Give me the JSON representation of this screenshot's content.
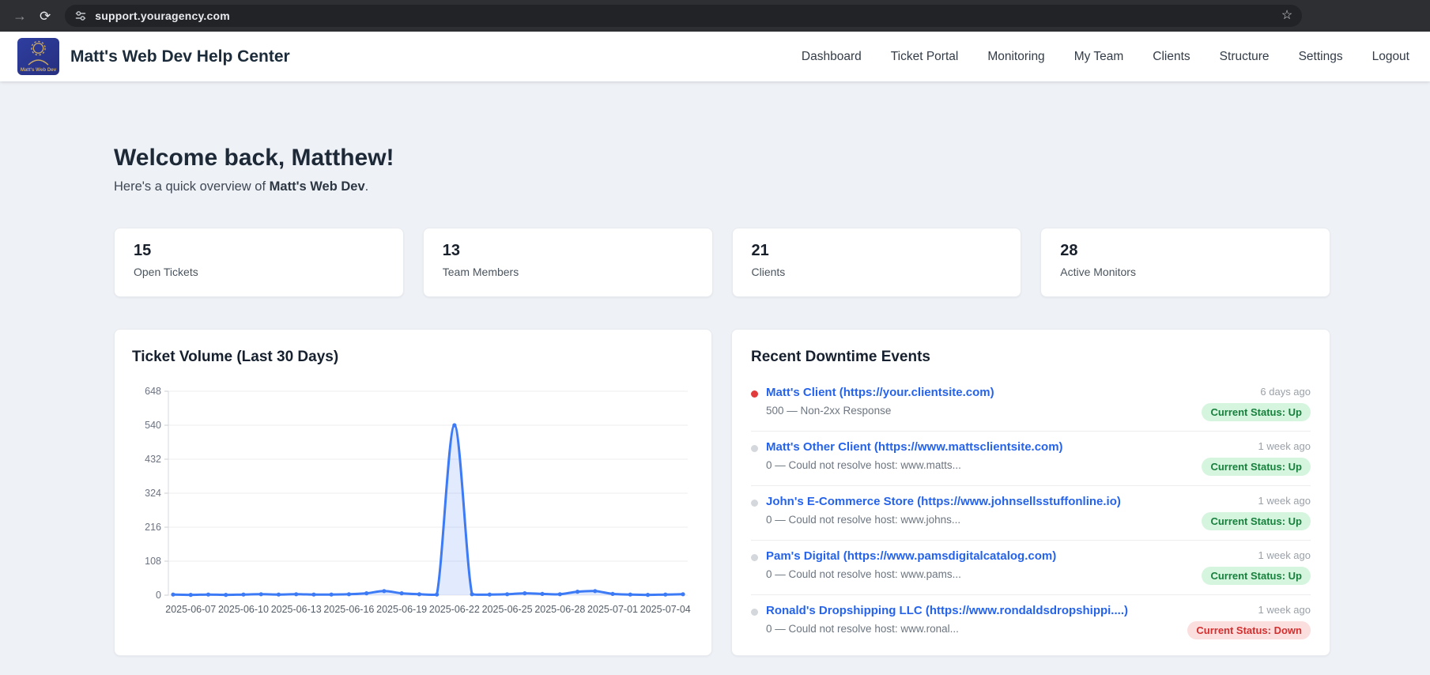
{
  "browser": {
    "url": "support.youragency.com",
    "forward_icon": "forward-arrow",
    "reload_icon": "reload",
    "site_info_icon": "tune-sliders",
    "bookmark_icon": "star-outline"
  },
  "header": {
    "brand": "Matt's Web Dev Help Center",
    "logo_text": "Matt's Web Dev",
    "nav": [
      {
        "label": "Dashboard"
      },
      {
        "label": "Ticket Portal"
      },
      {
        "label": "Monitoring"
      },
      {
        "label": "My Team"
      },
      {
        "label": "Clients"
      },
      {
        "label": "Structure"
      },
      {
        "label": "Settings"
      },
      {
        "label": "Logout"
      }
    ]
  },
  "welcome": {
    "title": "Welcome back, Matthew!",
    "subtitle_prefix": "Here's a quick overview of ",
    "subtitle_bold": "Matt's Web Dev",
    "subtitle_suffix": "."
  },
  "stats": [
    {
      "value": "15",
      "label": "Open Tickets"
    },
    {
      "value": "13",
      "label": "Team Members"
    },
    {
      "value": "21",
      "label": "Clients"
    },
    {
      "value": "28",
      "label": "Active Monitors"
    }
  ],
  "chart_data": {
    "type": "line",
    "title": "Ticket Volume (Last 30 Days)",
    "x": [
      "2025-06-06",
      "2025-06-07",
      "2025-06-08",
      "2025-06-09",
      "2025-06-10",
      "2025-06-11",
      "2025-06-12",
      "2025-06-13",
      "2025-06-14",
      "2025-06-15",
      "2025-06-16",
      "2025-06-17",
      "2025-06-18",
      "2025-06-19",
      "2025-06-20",
      "2025-06-21",
      "2025-06-22",
      "2025-06-23",
      "2025-06-24",
      "2025-06-25",
      "2025-06-26",
      "2025-06-27",
      "2025-06-28",
      "2025-06-29",
      "2025-06-30",
      "2025-07-01",
      "2025-07-02",
      "2025-07-03",
      "2025-07-04",
      "2025-07-05"
    ],
    "values": [
      2,
      1,
      2,
      1,
      2,
      3,
      2,
      3,
      2,
      2,
      3,
      6,
      13,
      6,
      3,
      2,
      540,
      3,
      2,
      3,
      6,
      4,
      3,
      11,
      13,
      4,
      2,
      1,
      2,
      3
    ],
    "x_tick_labels": [
      "2025-06-07",
      "2025-06-10",
      "2025-06-13",
      "2025-06-16",
      "2025-06-19",
      "2025-06-22",
      "2025-06-25",
      "2025-06-28",
      "2025-07-01",
      "2025-07-04"
    ],
    "y_ticks": [
      0,
      108,
      216,
      324,
      432,
      540,
      648
    ],
    "ylim": [
      0,
      648
    ],
    "xlabel": "",
    "ylabel": "",
    "legend": "none",
    "grid": "on",
    "line_color": "#3d7af5",
    "fill_color": "rgba(61,122,245,0.15)"
  },
  "events": {
    "title": "Recent Downtime Events",
    "items": [
      {
        "name": "Matt's Client (https://your.clientsite.com)",
        "message": "500 — Non-2xx Response",
        "time": "6 days ago",
        "status_label": "Current Status: Up",
        "status": "up",
        "dot": "red"
      },
      {
        "name": "Matt's Other Client (https://www.mattsclientsite.com)",
        "message": "0 — Could not resolve host: www.matts...",
        "time": "1 week ago",
        "status_label": "Current Status: Up",
        "status": "up",
        "dot": "gray"
      },
      {
        "name": "John's E-Commerce Store (https://www.johnsellsstuffonline.io)",
        "message": "0 — Could not resolve host: www.johns...",
        "time": "1 week ago",
        "status_label": "Current Status: Up",
        "status": "up",
        "dot": "gray"
      },
      {
        "name": "Pam's Digital (https://www.pamsdigitalcatalog.com)",
        "message": "0 — Could not resolve host: www.pams...",
        "time": "1 week ago",
        "status_label": "Current Status: Up",
        "status": "up",
        "dot": "gray"
      },
      {
        "name": "Ronald's Dropshipping LLC (https://www.rondaldsdropshippi....)",
        "message": "0 — Could not resolve host: www.ronal...",
        "time": "1 week ago",
        "status_label": "Current Status: Down",
        "status": "down",
        "dot": "gray"
      }
    ]
  },
  "colors": {
    "accent_blue": "#3d7af5",
    "link_blue": "#2563eb",
    "badge_up_bg": "#d6f5de",
    "badge_up_text": "#17803d",
    "badge_down_bg": "#fbdfdf",
    "badge_down_text": "#d22f2f",
    "event_dot_red": "#e23b3b",
    "page_background": "#eef1f6"
  }
}
